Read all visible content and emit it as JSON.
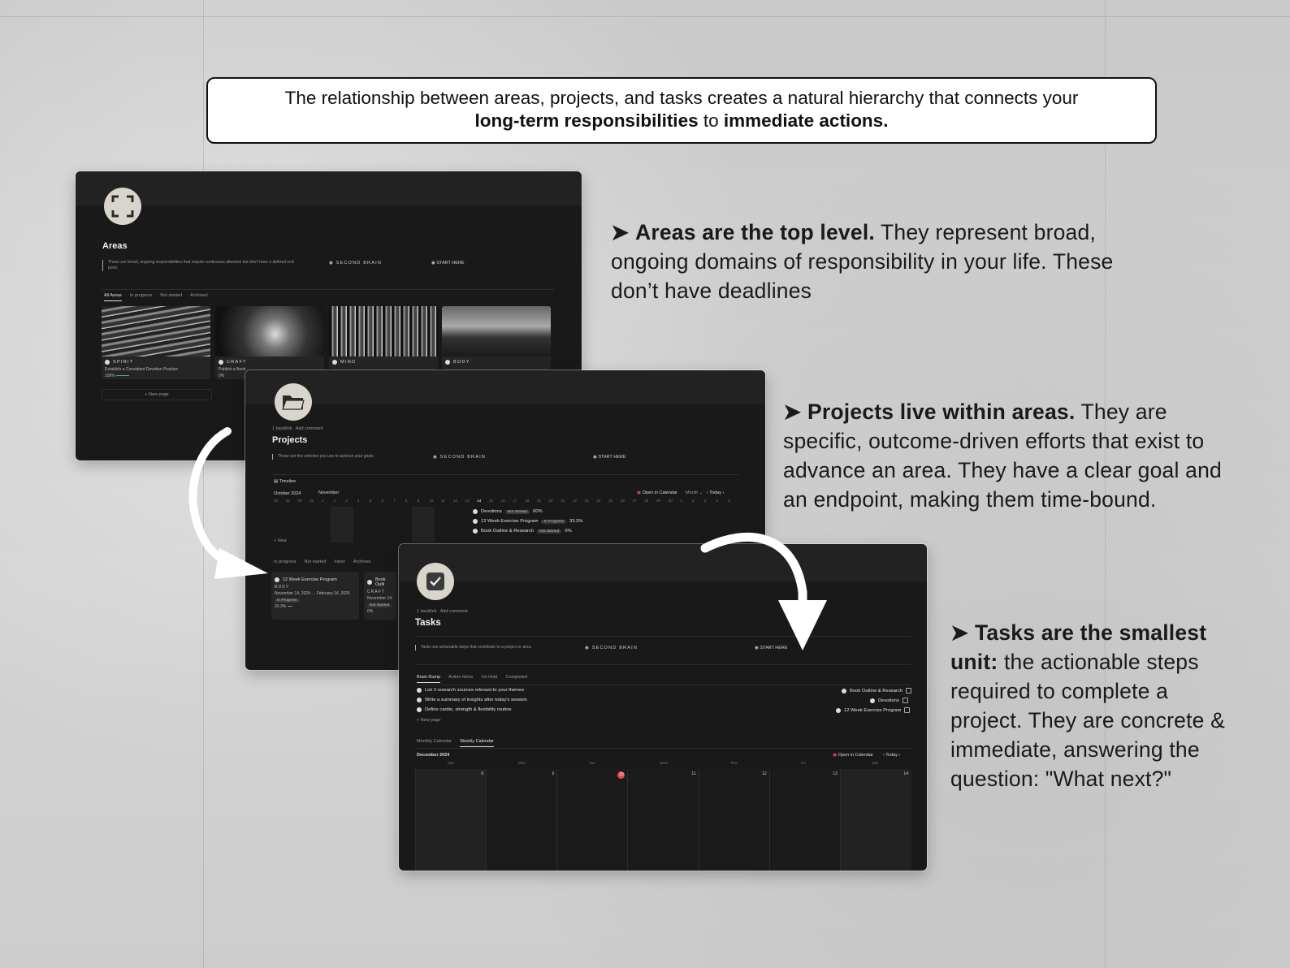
{
  "intro": {
    "line1": "The relationship between areas, projects, and tasks creates a natural hierarchy that connects your",
    "bold1": "long-term responsibilities",
    "mid": " to ",
    "bold2": "immediate actions."
  },
  "descriptions": {
    "areas": {
      "bullet": "➤",
      "lead": "Areas are the top level.",
      "body": " They represent broad, ongoing domains of responsibility in your life. These don’t have deadlines"
    },
    "projects": {
      "bullet": "➤",
      "lead": "Projects live within areas.",
      "body": " They are specific, outcome-driven efforts that exist to advance an area. They have a clear goal and an endpoint, making them time-bound."
    },
    "tasks": {
      "bullet": "➤",
      "lead": "Tasks are the smallest unit:",
      "body": " the actionable steps required to complete a project. They are concrete &  immediate, answering the question: \"What next?\""
    }
  },
  "areas_window": {
    "title": "Areas",
    "quote": "These are broad, ongoing responsibilities that require continuous attention but don't have a defined end point.",
    "link1": "SECOND BRAIN",
    "link2": "START HERE",
    "tabs": [
      "All Areas",
      "In progress",
      "Not started",
      "Archived"
    ],
    "cards": [
      {
        "name": "SPIRIT",
        "sub": "Establish a Consistent Devotion Practice",
        "progress": "100%"
      },
      {
        "name": "CRAFT",
        "sub": "Publish a Book",
        "progress": "0%"
      },
      {
        "name": "MIND",
        "sub": "",
        "progress": ""
      },
      {
        "name": "BODY",
        "sub": "",
        "progress": ""
      }
    ],
    "new_page": "+ New page"
  },
  "projects_window": {
    "meta1": "1 backlink",
    "meta2": "Add comment",
    "title": "Projects",
    "quote": "These are the vehicles you use to achieve your goals",
    "link1": "SECOND BRAIN",
    "link2": "START HERE",
    "timeline_label": "Timeline",
    "month1": "October 2024",
    "month2": "November",
    "open_calendar": "Open in Calendar",
    "month_select": "Month",
    "today": "Today",
    "days": [
      "28",
      "29",
      "30",
      "31",
      "1",
      "2",
      "3",
      "4",
      "5",
      "6",
      "7",
      "8",
      "9",
      "10",
      "11",
      "12",
      "13",
      "14",
      "15",
      "16",
      "17",
      "18",
      "19",
      "20",
      "21",
      "22",
      "23",
      "24",
      "25",
      "26",
      "27",
      "28",
      "29",
      "30",
      "1",
      "2",
      "3",
      "4",
      "5"
    ],
    "timeline_rows": [
      {
        "name": "Devotions",
        "status": "Not Started",
        "pct": "60%"
      },
      {
        "name": "12 Week Exercise Program",
        "status": "In Progress",
        "pct": "33.3%"
      },
      {
        "name": "Book Outline & Research",
        "status": "Not Started",
        "pct": "0%"
      }
    ],
    "new_label": "+ New",
    "tabs": [
      "In progress",
      "Not started",
      "Inbox",
      "Archived"
    ],
    "cards": [
      {
        "name": "12 Week Exercise Program",
        "area": "BODY",
        "dates": "November 14, 2024 → February 14, 2025",
        "status": "In Progress",
        "pct": "33.3%"
      },
      {
        "name": "Book Outli",
        "area": "CRAFT",
        "dates": "November 14,",
        "status": "Not Started",
        "pct": "0%"
      }
    ]
  },
  "tasks_window": {
    "meta1": "1 backlink",
    "meta2": "Add comment",
    "title": "Tasks",
    "quote": "Tasks are actionable steps that contribute to a project or area.",
    "link1": "SECOND BRAIN",
    "link2": "START HERE",
    "tabs": [
      "Brain Dump",
      "Action Items",
      "On Hold",
      "Completed"
    ],
    "tasks": [
      {
        "name": "List 3 research sources relevant to your themes",
        "project": "Book Outline & Research"
      },
      {
        "name": "Write a summary of insights after today's session",
        "project": "Devotions"
      },
      {
        "name": "Define cardio, strength & flexibility routine",
        "project": "12 Week Exercise Program"
      }
    ],
    "new_page": "+ New page",
    "cal_tabs": [
      "Monthly Calendar",
      "Weekly Calendar"
    ],
    "cal_month": "December 2024",
    "open_calendar": "Open in Calendar",
    "today": "Today",
    "weekdays": [
      "Sun",
      "Mon",
      "Tue",
      "Wed",
      "Thu",
      "Fri",
      "Sat"
    ],
    "dates": [
      "8",
      "9",
      "10",
      "11",
      "12",
      "13",
      "14"
    ],
    "today_date": "10"
  },
  "colors": {
    "window_bg": "#191919",
    "accent_red": "#e5484d",
    "progress_green": "#56a97a"
  },
  "icons": [
    "frame-icon",
    "folder-icon",
    "checkbox-icon",
    "curved-arrow-icon"
  ]
}
